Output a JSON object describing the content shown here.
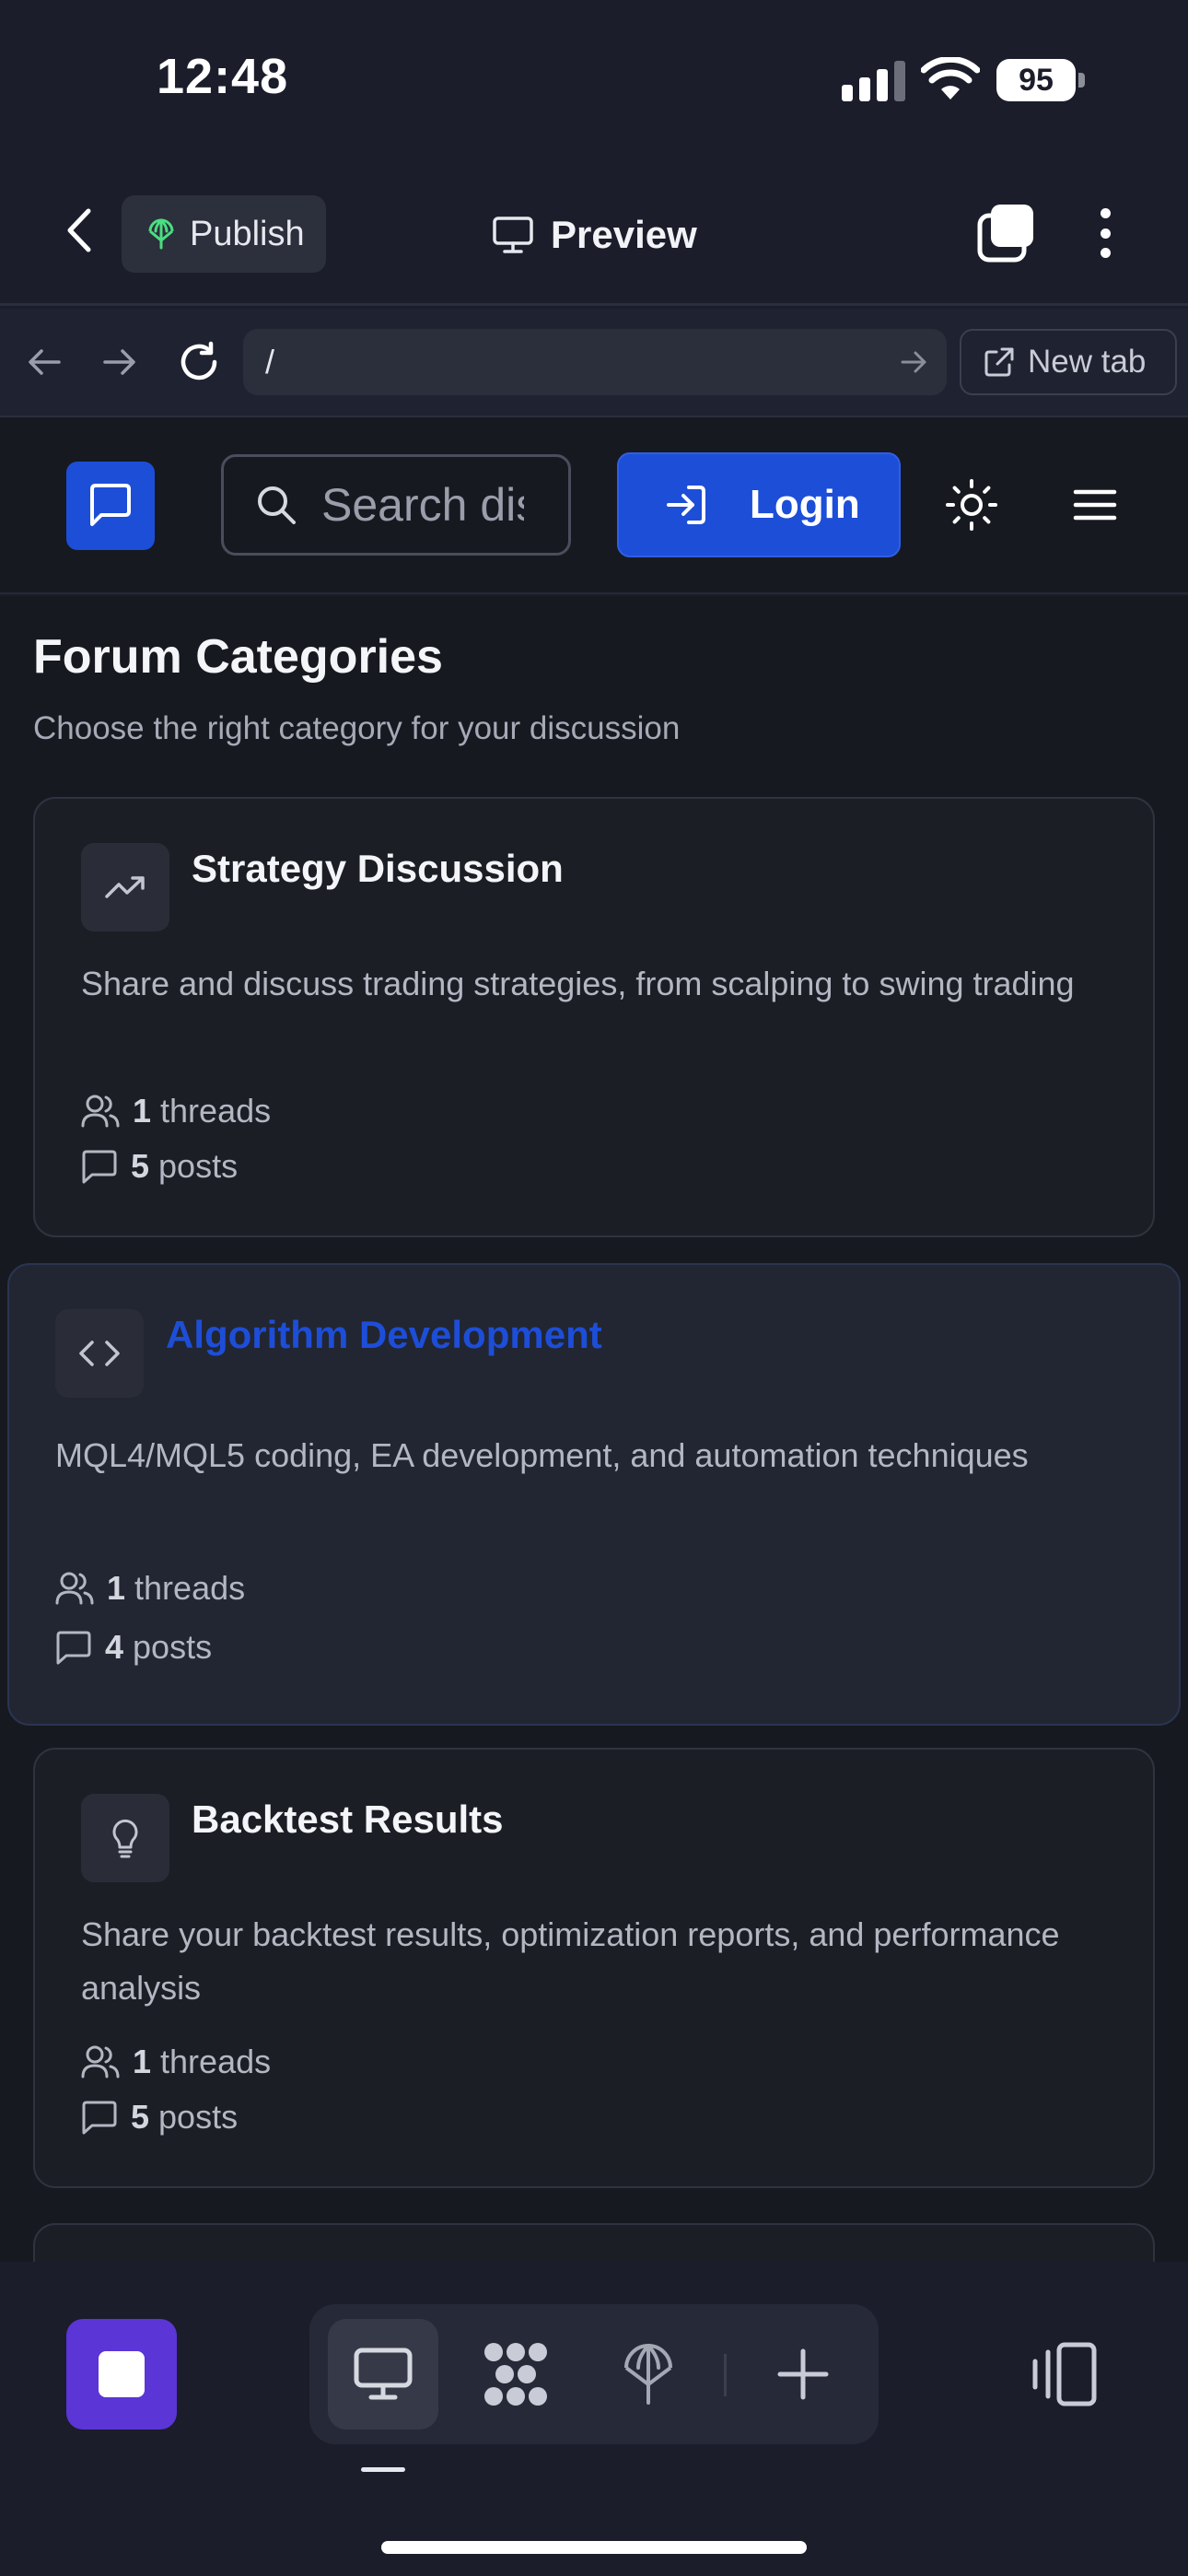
{
  "status_bar": {
    "time": "12:48",
    "battery_percent": "95"
  },
  "app_bar": {
    "publish_label": "Publish",
    "preview_label": "Preview"
  },
  "browser": {
    "url": "/",
    "new_tab_label": "New tab"
  },
  "site_header": {
    "search_placeholder": "Search discussions...",
    "login_label": "Login"
  },
  "page": {
    "title": "Forum Categories",
    "subtitle": "Choose the right category for your discussion"
  },
  "categories": [
    {
      "title": "Strategy Discussion",
      "icon": "trending-up-icon",
      "description": "Share and discuss trading strategies, from scalping to swing trading",
      "threads_count": "1",
      "threads_label": "threads",
      "posts_count": "5",
      "posts_label": "posts"
    },
    {
      "title": "Algorithm Development",
      "icon": "code-icon",
      "description": "MQL4/MQL5 coding, EA development, and automation techniques",
      "threads_count": "1",
      "threads_label": "threads",
      "posts_count": "4",
      "posts_label": "posts",
      "highlighted": true
    },
    {
      "title": "Backtest Results",
      "icon": "lightbulb-icon",
      "description": "Share your backtest results, optimization reports, and performance analysis",
      "threads_count": "1",
      "threads_label": "threads",
      "posts_count": "5",
      "posts_label": "posts"
    }
  ],
  "bottom_bar": {
    "modes": [
      "desktop-icon",
      "grid-icon",
      "publish-icon",
      "add-icon"
    ],
    "active_mode": "desktop-icon"
  },
  "colors": {
    "accent": "#1d4ed8",
    "app_square": "#5b35d5",
    "background": "#171920"
  }
}
